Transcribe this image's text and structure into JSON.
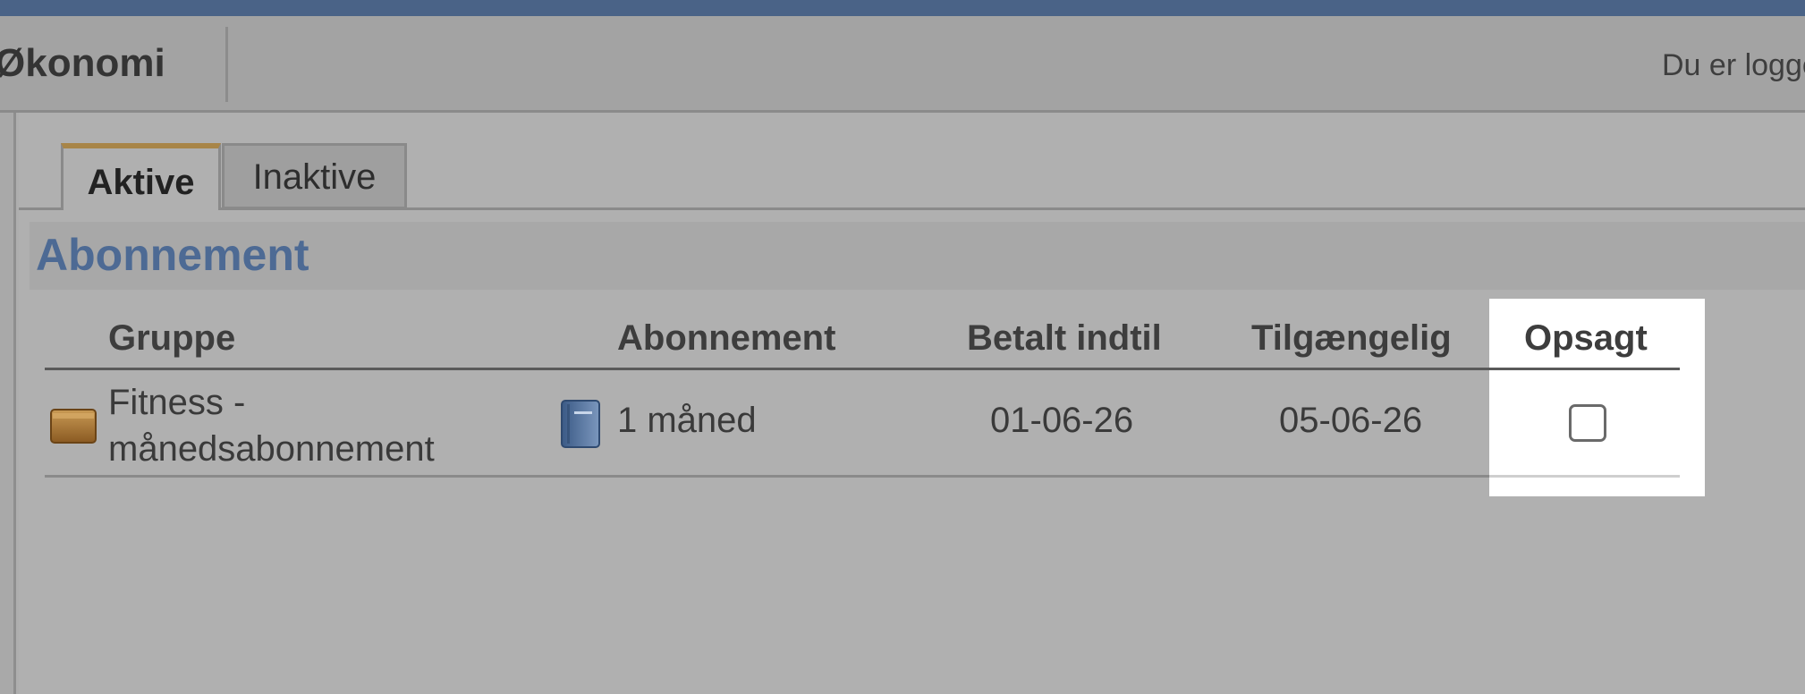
{
  "header": {
    "nav_item": "Økonomi",
    "login_text": "Du er logge"
  },
  "tabs": [
    {
      "label": "Aktive",
      "active": true
    },
    {
      "label": "Inaktive",
      "active": false
    }
  ],
  "section": {
    "title": "Abonnement"
  },
  "table": {
    "columns": [
      "Gruppe",
      "Abonnement",
      "Betalt indtil",
      "Tilgængelig",
      "Opsagt"
    ],
    "rows": [
      {
        "gruppe_line1": "Fitness -",
        "gruppe_line2": "månedsabonnement",
        "gruppe_icon": "folder-icon",
        "abonnement": "1 måned",
        "abonnement_icon": "book-icon",
        "betalt_indtil": "01-06-26",
        "tilgaengelig": "05-06-26",
        "opsagt": false
      }
    ]
  },
  "colors": {
    "topbar": "#4a6387",
    "section_title": "#4d6a94",
    "active_tab_accent": "#a88548",
    "highlight": "#ffffff"
  }
}
